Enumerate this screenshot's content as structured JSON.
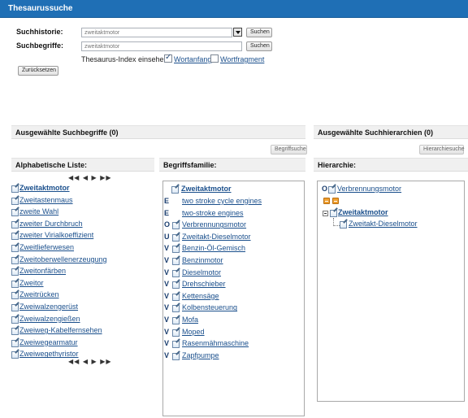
{
  "window": {
    "title": "Thesaurussuche"
  },
  "search": {
    "history_label": "Suchhistorie:",
    "history_value": "zweitaktmotor",
    "history_button": "Suchen",
    "terms_label": "Suchbegriffe:",
    "terms_value": "zweitaktmotor",
    "terms_button": "Suchen",
    "index_label": "Thesaurus-Index einsehen:",
    "option_wortanfang": "Wortanfang",
    "option_wortanfang_checked": true,
    "option_wortfragment": "Wortfragment",
    "option_wortfragment_checked": false,
    "reset_button": "Zurücksetzen"
  },
  "selected": {
    "terms_header": "Ausgewählte Suchbegriffe (0)",
    "terms_button": "Begriffsuche",
    "hier_header": "Ausgewählte Suchhierarchien (0)",
    "hier_button": "Hierarchiesuche"
  },
  "alpha": {
    "header": "Alphabetische Liste:",
    "pager": "◀◀ ◀ ▶ ▶▶",
    "items": [
      "Zweitaktmotor",
      "Zweitastenmaus",
      "zweite Wahl",
      "zweiter Durchbruch",
      "zweiter Virialkoeffizient",
      "Zweitlieferwesen",
      "Zweitoberwellenerzeugung",
      "Zweitonfärben",
      "Zweitor",
      "Zweitrücken",
      "Zweiwalzengerüst",
      "Zweiwalzengießen",
      "Zweiweg-Kabelfernsehen",
      "Zweiwegearmatur",
      "Zweiwegethyristor"
    ]
  },
  "family": {
    "header": "Begriffsfamilie:",
    "main": "Zweitaktmotor",
    "items": [
      {
        "rel": "E",
        "term": "two stroke cycle engines",
        "icon": false
      },
      {
        "rel": "E",
        "term": "two-stroke engines",
        "icon": false
      },
      {
        "rel": "O",
        "term": "Verbrennungsmotor",
        "icon": true
      },
      {
        "rel": "U",
        "term": "Zweitakt-Dieselmotor",
        "icon": true
      },
      {
        "rel": "V",
        "term": "Benzin-Öl-Gemisch",
        "icon": true
      },
      {
        "rel": "V",
        "term": "Benzinmotor",
        "icon": true
      },
      {
        "rel": "V",
        "term": "Dieselmotor",
        "icon": true
      },
      {
        "rel": "V",
        "term": "Drehschieber",
        "icon": true
      },
      {
        "rel": "V",
        "term": "Kettensäge",
        "icon": true
      },
      {
        "rel": "V",
        "term": "Kolbensteuerung",
        "icon": true
      },
      {
        "rel": "V",
        "term": "Mofa",
        "icon": true
      },
      {
        "rel": "V",
        "term": "Moped",
        "icon": true
      },
      {
        "rel": "V",
        "term": "Rasenmähmaschine",
        "icon": true
      },
      {
        "rel": "V",
        "term": "Zapfpumpe",
        "icon": true
      }
    ]
  },
  "hierarchy": {
    "header": "Hierarchie:",
    "parent_rel": "O",
    "parent": "Verbrennungsmotor",
    "current": "Zweitaktmotor",
    "child": "Zweitakt-Dieselmotor"
  }
}
